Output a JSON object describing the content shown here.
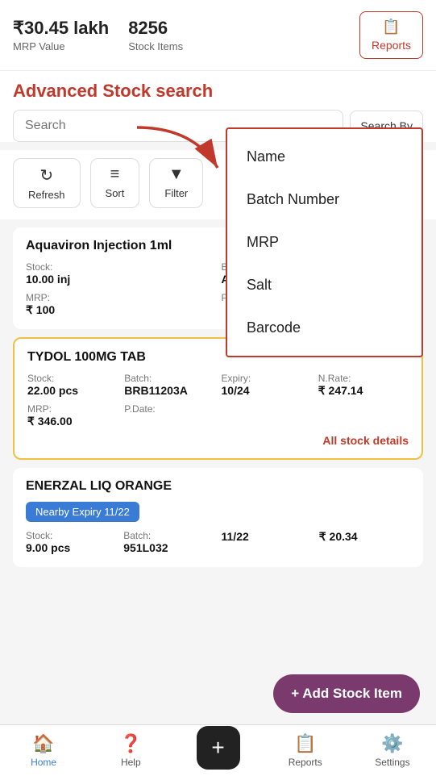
{
  "stats": {
    "mrp_value": "₹30.45 lakh",
    "mrp_label": "MRP Value",
    "stock_items": "8256",
    "stock_items_label": "Stock Items",
    "reports_label": "Reports"
  },
  "search": {
    "title": "Advanced Stock search",
    "placeholder": "Search",
    "search_by_label": "Search By"
  },
  "actions": {
    "refresh_label": "Refresh",
    "sort_label": "Sort",
    "filter_label": "Filter"
  },
  "dropdown": {
    "items": [
      "Name",
      "Batch Number",
      "MRP",
      "Salt",
      "Barcode"
    ]
  },
  "stock_items_list": [
    {
      "name": "Aquaviron Injection 1ml",
      "stock_value": "10.00 inj",
      "batch_value": "Asdf",
      "mrp_value": "₹ 100",
      "pdate_value": "",
      "highlighted": false,
      "show_expiry": false,
      "nearby_expiry": null
    },
    {
      "name": "TYDOL 100MG TAB",
      "stock_value": "22.00 pcs",
      "batch_value": "BRB11203A",
      "mrp_value": "₹ 346.00",
      "pdate_value": "",
      "expiry_value": "10/24",
      "nrate_value": "₹ 247.14",
      "highlighted": true,
      "show_expiry": true,
      "all_stock_label": "All stock details",
      "nearby_expiry": null
    },
    {
      "name": "ENERZAL LIQ ORANGE",
      "stock_value": "9.00 pcs",
      "batch_value": "951L032",
      "mrp_value": "",
      "pdate_value": "",
      "expiry_value": "11/22",
      "nrate_value": "₹ 20.34",
      "highlighted": false,
      "show_expiry": true,
      "all_stock_label": null,
      "nearby_expiry": "Nearby Expiry 11/22"
    }
  ],
  "add_stock_label": "+ Add Stock Item",
  "bottom_nav": {
    "home_label": "Home",
    "help_label": "Help",
    "reports_label": "Reports",
    "settings_label": "Settings"
  }
}
